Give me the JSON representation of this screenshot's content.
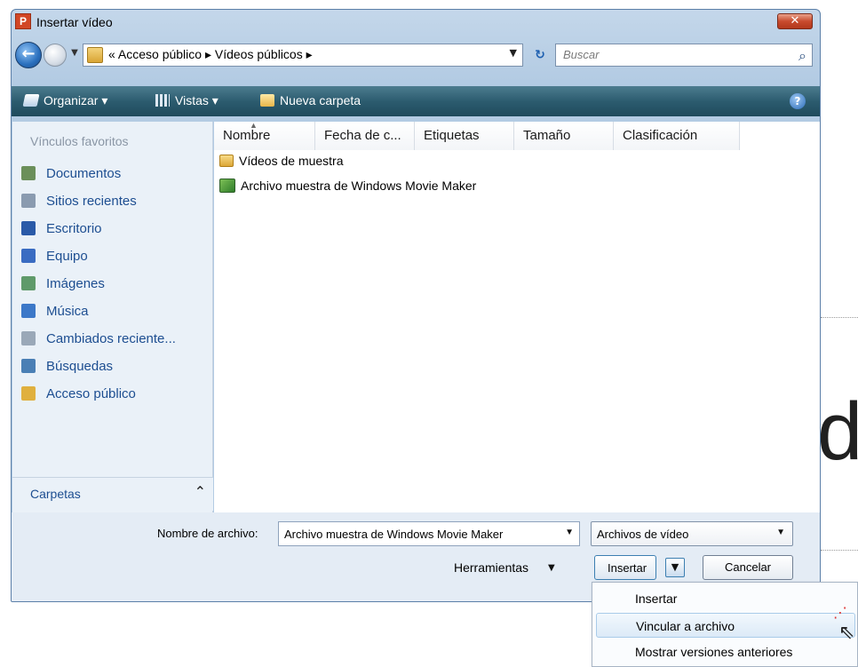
{
  "window": {
    "title": "Insertar vídeo",
    "app_icon": "P",
    "close_glyph": "✕"
  },
  "address": {
    "path": "«  Acceso público  ▸  Vídeos públicos  ▸",
    "search_placeholder": "Buscar"
  },
  "toolbar": {
    "organize": "Organizar ▾",
    "views": "Vistas ▾",
    "new_folder": "Nueva carpeta"
  },
  "sidebar": {
    "header": "Vínculos favoritos",
    "items": [
      {
        "label": "Documentos",
        "color": "#6b8f5a"
      },
      {
        "label": "Sitios recientes",
        "color": "#8a9bb0"
      },
      {
        "label": "Escritorio",
        "color": "#2a5aa8"
      },
      {
        "label": "Equipo",
        "color": "#3a6cc2"
      },
      {
        "label": "Imágenes",
        "color": "#5f9a6a"
      },
      {
        "label": "Música",
        "color": "#3c78c8"
      },
      {
        "label": "Cambiados reciente...",
        "color": "#9aa8b8"
      },
      {
        "label": "Búsquedas",
        "color": "#4a7fb5"
      },
      {
        "label": "Acceso público",
        "color": "#e0b03e"
      }
    ],
    "folders_label": "Carpetas"
  },
  "filelist": {
    "columns": [
      "Nombre",
      "Fecha de c...",
      "Etiquetas",
      "Tamaño",
      "Clasificación"
    ],
    "rows": [
      {
        "name": "Vídeos de muestra",
        "type": "folder"
      },
      {
        "name": "Archivo muestra de Windows Movie Maker",
        "type": "movie"
      }
    ]
  },
  "bottom": {
    "filename_label": "Nombre de archivo:",
    "filename_value": "Archivo muestra de Windows Movie Maker",
    "filetype_value": "Archivos de vídeo",
    "tools_label": "Herramientas",
    "insert_label": "Insertar",
    "cancel_label": "Cancelar"
  },
  "insert_menu": {
    "items": [
      "Insertar",
      "Vincular a archivo",
      "Mostrar versiones anteriores"
    ],
    "highlighted": "Vincular a archivo"
  },
  "background": {
    "letter": "d"
  }
}
